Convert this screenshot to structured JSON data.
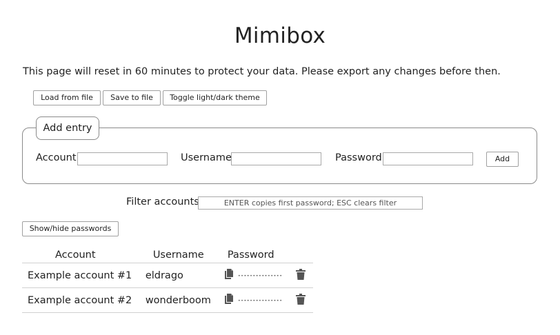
{
  "app": {
    "title": "Mimibox",
    "notice": "This page will reset in 60 minutes to protect your data. Please export any changes before then."
  },
  "toolbar": {
    "load_label": "Load from file",
    "save_label": "Save to file",
    "theme_label": "Toggle light/dark theme"
  },
  "add_entry": {
    "legend": "Add entry",
    "account_label": "Account",
    "account_value": "",
    "username_label": "Username",
    "username_value": "",
    "password_label": "Password",
    "password_value": "",
    "add_label": "Add"
  },
  "filter": {
    "label": "Filter accounts",
    "placeholder": "ENTER copies first password; ESC clears filter",
    "value": ""
  },
  "show_hide_label": "Show/hide passwords",
  "table": {
    "headers": [
      "Account",
      "Username",
      "Password"
    ],
    "rows": [
      {
        "account": "Example account #1",
        "username": "eldrago",
        "password_mask": "···············",
        "copy_icon": "copy-icon",
        "delete_icon": "trash-icon"
      },
      {
        "account": "Example account #2",
        "username": "wonderboom",
        "password_mask": "···············",
        "copy_icon": "copy-icon",
        "delete_icon": "trash-icon"
      }
    ]
  },
  "colors": {
    "text": "#222222",
    "border": "#8a8a8a",
    "icon": "#555555",
    "background": "#ffffff"
  }
}
